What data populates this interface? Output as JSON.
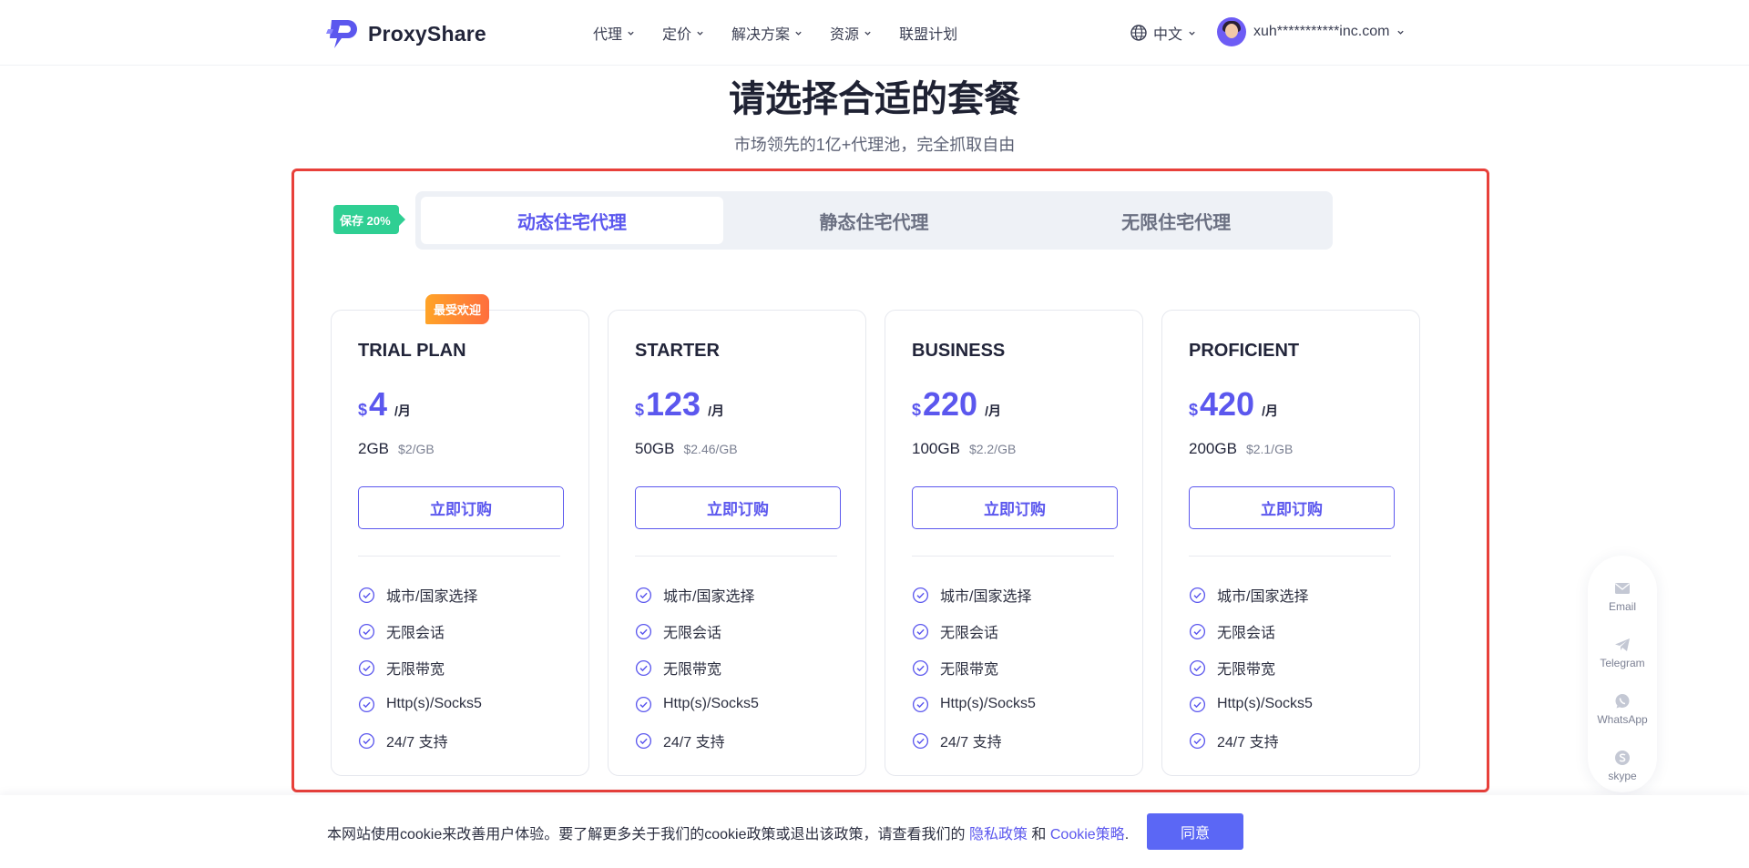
{
  "header": {
    "logo_text": "ProxyShare",
    "nav": [
      {
        "label": "代理",
        "has_dropdown": true
      },
      {
        "label": "定价",
        "has_dropdown": true
      },
      {
        "label": "解决方案",
        "has_dropdown": true
      },
      {
        "label": "资源",
        "has_dropdown": true
      },
      {
        "label": "联盟计划",
        "has_dropdown": false
      }
    ],
    "language": "中文",
    "user_email": "xuh***********inc.com"
  },
  "hero": {
    "title": "请选择合适的套餐",
    "subtitle": "市场领先的1亿+代理池，完全抓取自由"
  },
  "save_badge": "保存 20%",
  "tabs": [
    {
      "label": "动态住宅代理",
      "active": true
    },
    {
      "label": "静态住宅代理",
      "active": false
    },
    {
      "label": "无限住宅代理",
      "active": false
    }
  ],
  "popular_badge": "最受欢迎",
  "plans": [
    {
      "name": "TRIAL PLAN",
      "currency": "$",
      "price": "4",
      "period": "/月",
      "volume": "2GB",
      "unit_price": "$2/GB",
      "button": "立即订购"
    },
    {
      "name": "STARTER",
      "currency": "$",
      "price": "123",
      "period": "/月",
      "volume": "50GB",
      "unit_price": "$2.46/GB",
      "button": "立即订购"
    },
    {
      "name": "BUSINESS",
      "currency": "$",
      "price": "220",
      "period": "/月",
      "volume": "100GB",
      "unit_price": "$2.2/GB",
      "button": "立即订购"
    },
    {
      "name": "PROFICIENT",
      "currency": "$",
      "price": "420",
      "period": "/月",
      "volume": "200GB",
      "unit_price": "$2.1/GB",
      "button": "立即订购"
    }
  ],
  "features": [
    "城市/国家选择",
    "无限会话",
    "无限带宽",
    "Http(s)/Socks5",
    "24/7 支持"
  ],
  "contact": [
    {
      "label": "Email",
      "icon": "email-icon"
    },
    {
      "label": "Telegram",
      "icon": "telegram-icon"
    },
    {
      "label": "WhatsApp",
      "icon": "whatsapp-icon"
    },
    {
      "label": "skype",
      "icon": "skype-icon"
    }
  ],
  "cookie": {
    "text": "本网站使用cookie来改善用户体验。要了解更多关于我们的cookie政策或退出该政策，请查看我们的 ",
    "privacy_link": "隐私政策",
    "and": " 和 ",
    "cookie_link": "Cookie策略",
    "period": ".",
    "agree": "同意"
  },
  "colors": {
    "accent": "#5b57ee",
    "highlight_border": "#e8403a",
    "save_badge": "#2fcf93",
    "popular_badge": "#ff8a33"
  }
}
